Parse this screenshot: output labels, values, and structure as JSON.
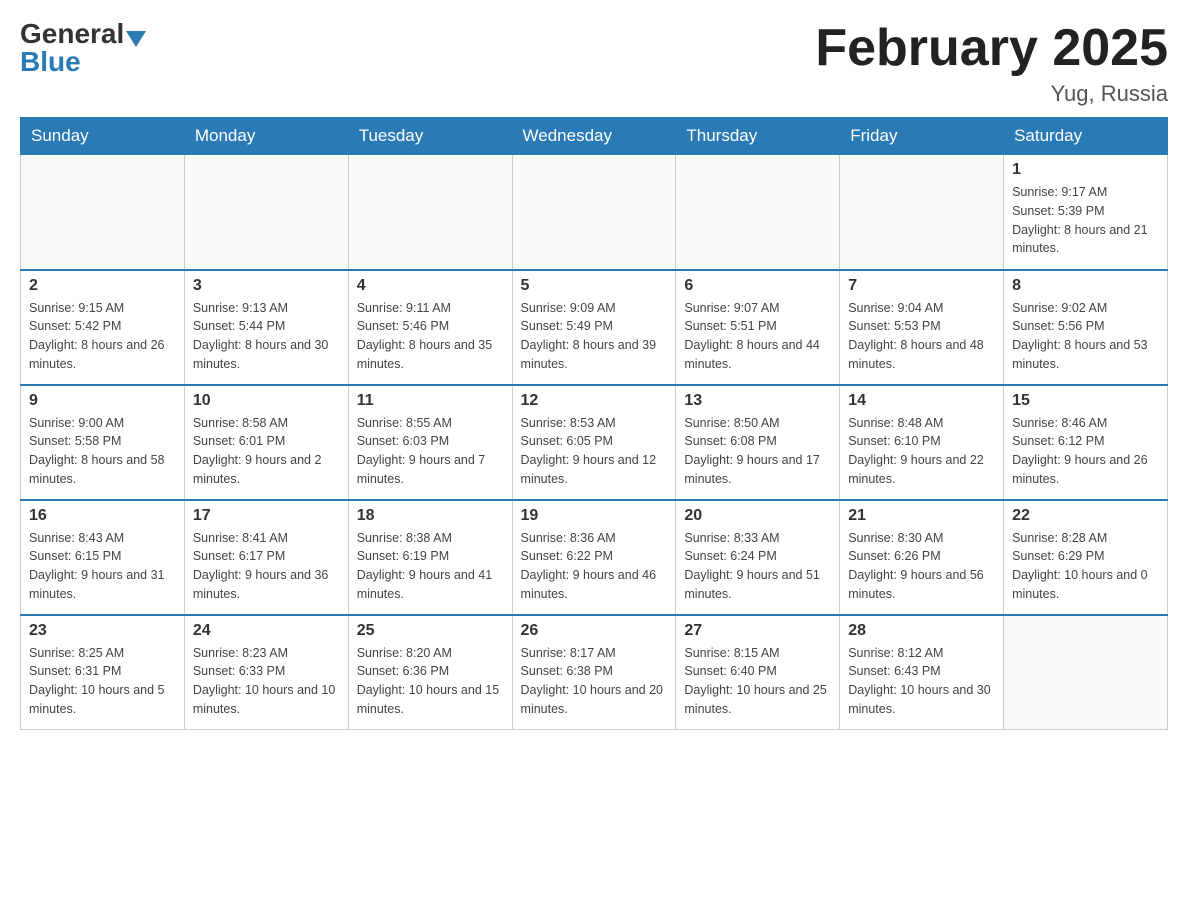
{
  "header": {
    "logo_general": "General",
    "logo_blue": "Blue",
    "month_title": "February 2025",
    "location": "Yug, Russia"
  },
  "weekdays": [
    "Sunday",
    "Monday",
    "Tuesday",
    "Wednesday",
    "Thursday",
    "Friday",
    "Saturday"
  ],
  "weeks": [
    [
      {
        "day": "",
        "sunrise": "",
        "sunset": "",
        "daylight": ""
      },
      {
        "day": "",
        "sunrise": "",
        "sunset": "",
        "daylight": ""
      },
      {
        "day": "",
        "sunrise": "",
        "sunset": "",
        "daylight": ""
      },
      {
        "day": "",
        "sunrise": "",
        "sunset": "",
        "daylight": ""
      },
      {
        "day": "",
        "sunrise": "",
        "sunset": "",
        "daylight": ""
      },
      {
        "day": "",
        "sunrise": "",
        "sunset": "",
        "daylight": ""
      },
      {
        "day": "1",
        "sunrise": "Sunrise: 9:17 AM",
        "sunset": "Sunset: 5:39 PM",
        "daylight": "Daylight: 8 hours and 21 minutes."
      }
    ],
    [
      {
        "day": "2",
        "sunrise": "Sunrise: 9:15 AM",
        "sunset": "Sunset: 5:42 PM",
        "daylight": "Daylight: 8 hours and 26 minutes."
      },
      {
        "day": "3",
        "sunrise": "Sunrise: 9:13 AM",
        "sunset": "Sunset: 5:44 PM",
        "daylight": "Daylight: 8 hours and 30 minutes."
      },
      {
        "day": "4",
        "sunrise": "Sunrise: 9:11 AM",
        "sunset": "Sunset: 5:46 PM",
        "daylight": "Daylight: 8 hours and 35 minutes."
      },
      {
        "day": "5",
        "sunrise": "Sunrise: 9:09 AM",
        "sunset": "Sunset: 5:49 PM",
        "daylight": "Daylight: 8 hours and 39 minutes."
      },
      {
        "day": "6",
        "sunrise": "Sunrise: 9:07 AM",
        "sunset": "Sunset: 5:51 PM",
        "daylight": "Daylight: 8 hours and 44 minutes."
      },
      {
        "day": "7",
        "sunrise": "Sunrise: 9:04 AM",
        "sunset": "Sunset: 5:53 PM",
        "daylight": "Daylight: 8 hours and 48 minutes."
      },
      {
        "day": "8",
        "sunrise": "Sunrise: 9:02 AM",
        "sunset": "Sunset: 5:56 PM",
        "daylight": "Daylight: 8 hours and 53 minutes."
      }
    ],
    [
      {
        "day": "9",
        "sunrise": "Sunrise: 9:00 AM",
        "sunset": "Sunset: 5:58 PM",
        "daylight": "Daylight: 8 hours and 58 minutes."
      },
      {
        "day": "10",
        "sunrise": "Sunrise: 8:58 AM",
        "sunset": "Sunset: 6:01 PM",
        "daylight": "Daylight: 9 hours and 2 minutes."
      },
      {
        "day": "11",
        "sunrise": "Sunrise: 8:55 AM",
        "sunset": "Sunset: 6:03 PM",
        "daylight": "Daylight: 9 hours and 7 minutes."
      },
      {
        "day": "12",
        "sunrise": "Sunrise: 8:53 AM",
        "sunset": "Sunset: 6:05 PM",
        "daylight": "Daylight: 9 hours and 12 minutes."
      },
      {
        "day": "13",
        "sunrise": "Sunrise: 8:50 AM",
        "sunset": "Sunset: 6:08 PM",
        "daylight": "Daylight: 9 hours and 17 minutes."
      },
      {
        "day": "14",
        "sunrise": "Sunrise: 8:48 AM",
        "sunset": "Sunset: 6:10 PM",
        "daylight": "Daylight: 9 hours and 22 minutes."
      },
      {
        "day": "15",
        "sunrise": "Sunrise: 8:46 AM",
        "sunset": "Sunset: 6:12 PM",
        "daylight": "Daylight: 9 hours and 26 minutes."
      }
    ],
    [
      {
        "day": "16",
        "sunrise": "Sunrise: 8:43 AM",
        "sunset": "Sunset: 6:15 PM",
        "daylight": "Daylight: 9 hours and 31 minutes."
      },
      {
        "day": "17",
        "sunrise": "Sunrise: 8:41 AM",
        "sunset": "Sunset: 6:17 PM",
        "daylight": "Daylight: 9 hours and 36 minutes."
      },
      {
        "day": "18",
        "sunrise": "Sunrise: 8:38 AM",
        "sunset": "Sunset: 6:19 PM",
        "daylight": "Daylight: 9 hours and 41 minutes."
      },
      {
        "day": "19",
        "sunrise": "Sunrise: 8:36 AM",
        "sunset": "Sunset: 6:22 PM",
        "daylight": "Daylight: 9 hours and 46 minutes."
      },
      {
        "day": "20",
        "sunrise": "Sunrise: 8:33 AM",
        "sunset": "Sunset: 6:24 PM",
        "daylight": "Daylight: 9 hours and 51 minutes."
      },
      {
        "day": "21",
        "sunrise": "Sunrise: 8:30 AM",
        "sunset": "Sunset: 6:26 PM",
        "daylight": "Daylight: 9 hours and 56 minutes."
      },
      {
        "day": "22",
        "sunrise": "Sunrise: 8:28 AM",
        "sunset": "Sunset: 6:29 PM",
        "daylight": "Daylight: 10 hours and 0 minutes."
      }
    ],
    [
      {
        "day": "23",
        "sunrise": "Sunrise: 8:25 AM",
        "sunset": "Sunset: 6:31 PM",
        "daylight": "Daylight: 10 hours and 5 minutes."
      },
      {
        "day": "24",
        "sunrise": "Sunrise: 8:23 AM",
        "sunset": "Sunset: 6:33 PM",
        "daylight": "Daylight: 10 hours and 10 minutes."
      },
      {
        "day": "25",
        "sunrise": "Sunrise: 8:20 AM",
        "sunset": "Sunset: 6:36 PM",
        "daylight": "Daylight: 10 hours and 15 minutes."
      },
      {
        "day": "26",
        "sunrise": "Sunrise: 8:17 AM",
        "sunset": "Sunset: 6:38 PM",
        "daylight": "Daylight: 10 hours and 20 minutes."
      },
      {
        "day": "27",
        "sunrise": "Sunrise: 8:15 AM",
        "sunset": "Sunset: 6:40 PM",
        "daylight": "Daylight: 10 hours and 25 minutes."
      },
      {
        "day": "28",
        "sunrise": "Sunrise: 8:12 AM",
        "sunset": "Sunset: 6:43 PM",
        "daylight": "Daylight: 10 hours and 30 minutes."
      },
      {
        "day": "",
        "sunrise": "",
        "sunset": "",
        "daylight": ""
      }
    ]
  ]
}
